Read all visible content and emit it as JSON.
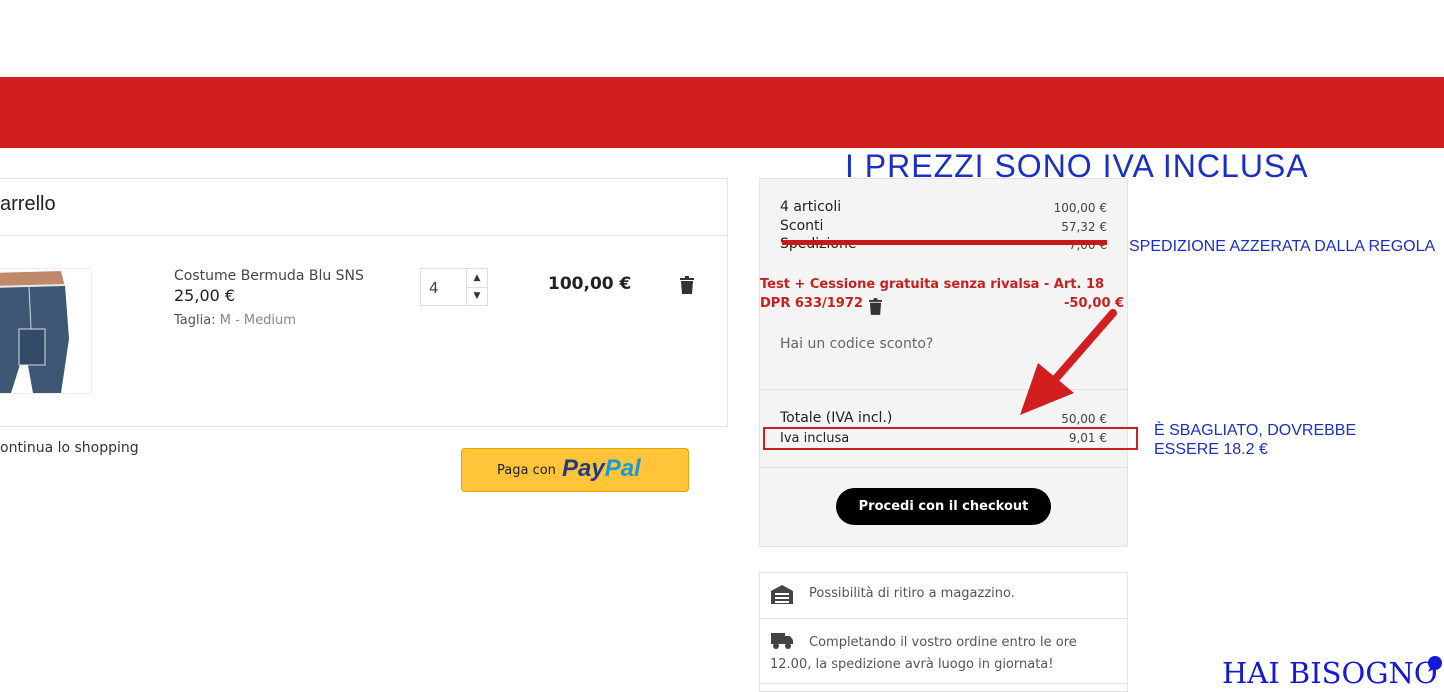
{
  "cart": {
    "title": "arrello",
    "product": {
      "name": "Costume Bermuda Blu SNS",
      "price": "25,00 €",
      "size_label": "Taglia:",
      "size_value": "M - Medium",
      "quantity": "4",
      "line_total": "100,00 €",
      "image_icon": "shorts-photo"
    },
    "continue_label": "ontinua lo shopping",
    "paypal": {
      "prefix": "Paga con",
      "brand_a": "Pay",
      "brand_b": "Pal"
    }
  },
  "summary": {
    "items_label": "4 articoli",
    "items_value": "100,00 €",
    "discount_label": "Sconti",
    "discount_value": "57,32 €",
    "shipping_label": "Spedizione",
    "shipping_value": "7,00 €",
    "promo_line1": "Test + Cessione gratuita senza rivalsa - Art. 18",
    "promo_line2": "DPR 633/1972",
    "promo_value": "-50,00 €",
    "coupon_prompt": "Hai un codice sconto?",
    "total_label": "Totale (IVA incl.)",
    "total_value": "50,00 €",
    "vat_label": "Iva inclusa",
    "vat_value": "9,01 €",
    "checkout_label": "Procedi con il checkout"
  },
  "reassurance": {
    "item1": "Possibilità di ritiro a magazzino.",
    "item2": "Completando il vostro ordine entro le ore 12.00, la spedizione avrà luogo in giornata!",
    "icon1": "warehouse-icon",
    "icon2": "truck-icon"
  },
  "annotations": {
    "title": "I PREZZI SONO IVA INCLUSA",
    "shipping_note": "SPEDIZIONE AZZERATA DALLA REGOLA",
    "wrong_line1": "È SBAGLIATO, DOVREBBE",
    "wrong_line2": "ESSERE 18.2 €",
    "help": "HAI BISOGNO"
  },
  "colors": {
    "header_red": "#d21e1e",
    "annotation_blue": "#1a2fc6",
    "promo_red": "#c62020",
    "paypal_yellow": "#ffc439"
  }
}
